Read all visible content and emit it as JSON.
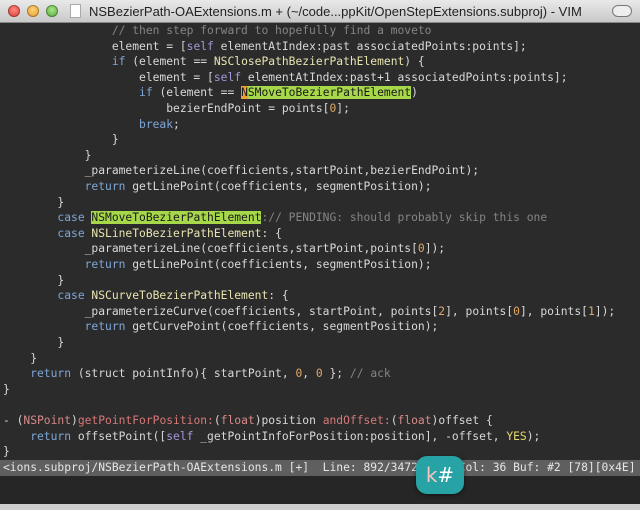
{
  "window": {
    "title": "NSBezierPath-OAExtensions.m + (~/code...ppKit/OpenStepExtensions.subproj) - VIM"
  },
  "colors": {
    "background": "#2b2b2b",
    "keyword": "#7fa6d6",
    "constant": "#e8e4b0",
    "search_highlight": "#a6d84a",
    "comment": "#858585",
    "status_bar": "#5f5f5f",
    "keycast_badge": "#27a3a5"
  },
  "code_lines": [
    [
      [
        "m",
        "                // then step forward to hopefully find a moveto"
      ]
    ],
    [
      [
        "p",
        "                element = ["
      ],
      [
        "s",
        "self"
      ],
      [
        "p",
        " elementAtIndex:past associatedPoints:points];"
      ]
    ],
    [
      [
        "k",
        "                if"
      ],
      [
        "p",
        " (element == "
      ],
      [
        "c",
        "NSClosePathBezierPathElement"
      ],
      [
        "p",
        ") {"
      ]
    ],
    [
      [
        "p",
        "                    element = ["
      ],
      [
        "s",
        "self"
      ],
      [
        "p",
        " elementAtIndex:past+1 associatedPoints:points];"
      ]
    ],
    [
      [
        "k",
        "                    if"
      ],
      [
        "p",
        " (element == "
      ],
      [
        "cur",
        "N"
      ],
      [
        "h",
        "SMoveToBezierPathElement"
      ],
      [
        "p",
        ")"
      ]
    ],
    [
      [
        "p",
        "                        bezierEndPoint = points["
      ],
      [
        "n",
        "0"
      ],
      [
        "p",
        "];"
      ]
    ],
    [
      [
        "k",
        "                    break"
      ],
      [
        "p",
        ";"
      ]
    ],
    [
      [
        "p",
        "                }"
      ]
    ],
    [
      [
        "p",
        "            }"
      ]
    ],
    [
      [
        "p",
        "            _parameterizeLine(coefficients,startPoint,bezierEndPoint);"
      ]
    ],
    [
      [
        "k",
        "            return"
      ],
      [
        "p",
        " getLinePoint(coefficients, segmentPosition);"
      ]
    ],
    [
      [
        "p",
        "        }"
      ]
    ],
    [
      [
        "k",
        "        case "
      ],
      [
        "h",
        "NSMoveToBezierPathElement"
      ],
      [
        "m",
        ":// PENDING: should probably skip this one"
      ]
    ],
    [
      [
        "k",
        "        case "
      ],
      [
        "c",
        "NSLineToBezierPathElement"
      ],
      [
        "p",
        ": {"
      ]
    ],
    [
      [
        "p",
        "            _parameterizeLine(coefficients,startPoint,points["
      ],
      [
        "n",
        "0"
      ],
      [
        "p",
        "]);"
      ]
    ],
    [
      [
        "k",
        "            return"
      ],
      [
        "p",
        " getLinePoint(coefficients, segmentPosition);"
      ]
    ],
    [
      [
        "p",
        "        }"
      ]
    ],
    [
      [
        "k",
        "        case "
      ],
      [
        "c",
        "NSCurveToBezierPathElement"
      ],
      [
        "p",
        ": {"
      ]
    ],
    [
      [
        "p",
        "            _parameterizeCurve(coefficients, startPoint, points["
      ],
      [
        "n",
        "2"
      ],
      [
        "p",
        "], points["
      ],
      [
        "n",
        "0"
      ],
      [
        "p",
        "], points["
      ],
      [
        "n",
        "1"
      ],
      [
        "p",
        "]);"
      ]
    ],
    [
      [
        "k",
        "            return"
      ],
      [
        "p",
        " getCurvePoint(coefficients, segmentPosition);"
      ]
    ],
    [
      [
        "p",
        "        }"
      ]
    ],
    [
      [
        "p",
        "    }"
      ]
    ],
    [
      [
        "k",
        "    return"
      ],
      [
        "p",
        " (struct pointInfo){ startPoint, "
      ],
      [
        "n",
        "0"
      ],
      [
        "p",
        ", "
      ],
      [
        "n",
        "0"
      ],
      [
        "p",
        " }; "
      ],
      [
        "m",
        "// ack"
      ]
    ],
    [
      [
        "p",
        "}"
      ]
    ],
    [
      [
        "p",
        " "
      ]
    ],
    [
      [
        "p",
        "- ("
      ],
      [
        "t",
        "NSPoint"
      ],
      [
        "p",
        ")"
      ],
      [
        "f",
        "getPointForPosition:"
      ],
      [
        "p",
        "("
      ],
      [
        "t",
        "float"
      ],
      [
        "p",
        ")position "
      ],
      [
        "f",
        "andOffset:"
      ],
      [
        "p",
        "("
      ],
      [
        "t",
        "float"
      ],
      [
        "p",
        ")offset {"
      ]
    ],
    [
      [
        "k",
        "    return"
      ],
      [
        "p",
        " offsetPoint(["
      ],
      [
        "s",
        "self"
      ],
      [
        "p",
        " _getPointInfoForPosition:position], -offset, "
      ],
      [
        "y",
        "YES"
      ],
      [
        "p",
        ");"
      ]
    ],
    [
      [
        "p",
        "}"
      ]
    ]
  ],
  "status_line": "<ions.subproj/NSBezierPath-OAExtensions.m [+]  Line: 892/3472[25%] Col: 36 Buf: #2 [78][0x4E]",
  "keycast": {
    "key": "k",
    "symbol": "#"
  }
}
